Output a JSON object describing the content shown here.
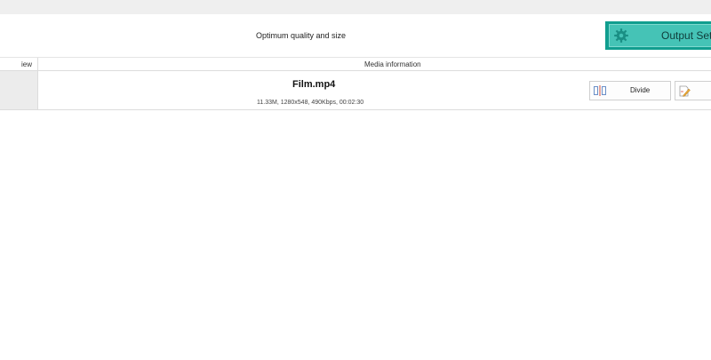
{
  "toolbar": {
    "quality_text": "Optimum quality and size",
    "output_settings_label": "Output Setti",
    "accent_color": "#119e8f",
    "output_icon": "gear-icon"
  },
  "table": {
    "columns": [
      "iew",
      "Media information"
    ],
    "rows": [
      {
        "filename": "Film.mp4",
        "info": "11.33M, 1280x548, 490Kbps, 00:02:30",
        "divide_label": "Divide",
        "divide_icon": "split-icon",
        "edit_icon": "edit-file-icon"
      }
    ]
  }
}
